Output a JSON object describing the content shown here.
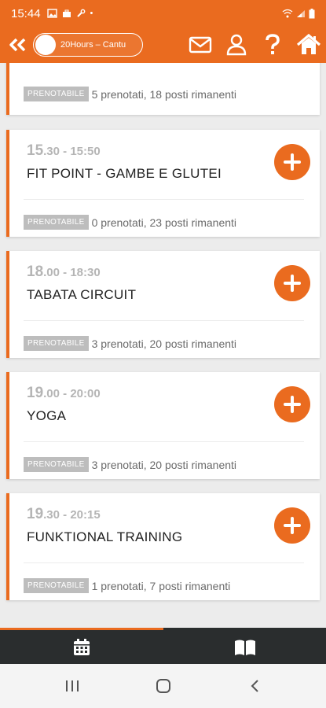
{
  "status": {
    "time": "15:44",
    "dot": "•"
  },
  "header": {
    "club_name": "20Hours – Cantu"
  },
  "colors": {
    "accent": "#ea6b1f",
    "tabbar": "#2a2d2e",
    "badge": "#bdbdbd"
  },
  "partial_card": {
    "badge": "PRENOTABILE",
    "info": "5 prenotati, 18 posti rimanenti"
  },
  "classes": [
    {
      "hour": "15",
      "rest": ".30 - 15:50",
      "title": "FIT POINT - GAMBE E GLUTEI",
      "badge": "PRENOTABILE",
      "info": "0 prenotati, 23 posti rimanenti"
    },
    {
      "hour": "18",
      "rest": ".00 - 18:30",
      "title": "TABATA CIRCUIT",
      "badge": "PRENOTABILE",
      "info": "3 prenotati, 20 posti rimanenti"
    },
    {
      "hour": "19",
      "rest": ".00 - 20:00",
      "title": "YOGA",
      "badge": "PRENOTABILE",
      "info": "3 prenotati, 20 posti rimanenti"
    },
    {
      "hour": "19",
      "rest": ".30 - 20:15",
      "title": "FUNKTIONAL TRAINING",
      "badge": "PRENOTABILE",
      "info": "1 prenotati, 7 posti rimanenti"
    }
  ],
  "icons": {
    "back": "double-chevron-left-icon",
    "mail": "mail-icon",
    "profile": "user-icon",
    "help": "question-mark-icon",
    "home": "home-icon",
    "add": "plus-icon",
    "calendar": "calendar-icon",
    "book": "book-icon"
  }
}
